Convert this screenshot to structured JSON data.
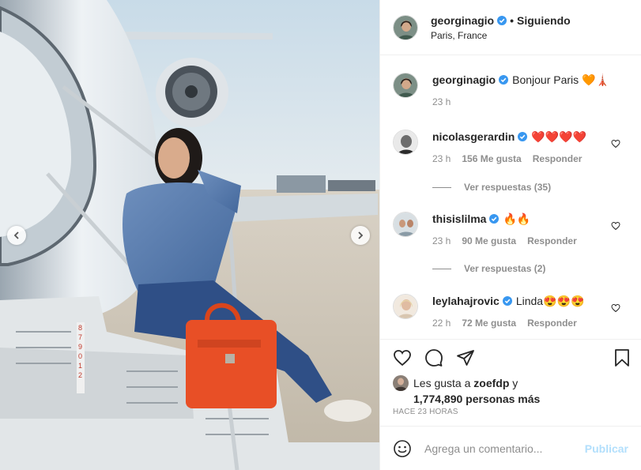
{
  "post": {
    "author": {
      "username": "georginagio",
      "verified": true,
      "follow_state": "Siguiendo",
      "separator": "•",
      "location": "Paris, France"
    },
    "caption": {
      "username": "georginagio",
      "text": "Bonjour Paris 🧡🗼",
      "time": "23 h"
    },
    "comments": [
      {
        "username": "nicolasgerardin",
        "verified": true,
        "text": "❤️❤️❤️❤️",
        "time": "23 h",
        "likes": "156 Me gusta",
        "reply_label": "Responder",
        "view_replies": "Ver respuestas (35)"
      },
      {
        "username": "thisislilma",
        "verified": true,
        "text": "🔥🔥",
        "time": "23 h",
        "likes": "90 Me gusta",
        "reply_label": "Responder",
        "view_replies": "Ver respuestas (2)"
      },
      {
        "username": "leylahajrovic",
        "verified": true,
        "text": "Linda😍😍😍",
        "time": "22 h",
        "likes": "72 Me gusta",
        "reply_label": "Responder"
      }
    ],
    "liked_by": {
      "prefix": "Les gusta a",
      "user": "zoefdp",
      "joiner": "y",
      "others": "1,774,890 personas más"
    },
    "posted": "HACE 23 HORAS",
    "add_comment": {
      "placeholder": "Agrega un comentario...",
      "publish": "Publicar"
    }
  },
  "icons": {
    "carousel_prev": "chevron-left-icon",
    "carousel_next": "chevron-right-icon",
    "like": "heart-icon",
    "comment": "comment-bubble-icon",
    "share": "paper-plane-icon",
    "save": "bookmark-icon",
    "emoji": "smiley-icon",
    "verified": "verified-badge-icon"
  },
  "colors": {
    "verified": "#3897f0",
    "publish_disabled": "#b2dffc",
    "muted": "#8e8e8e",
    "text": "#262626"
  }
}
